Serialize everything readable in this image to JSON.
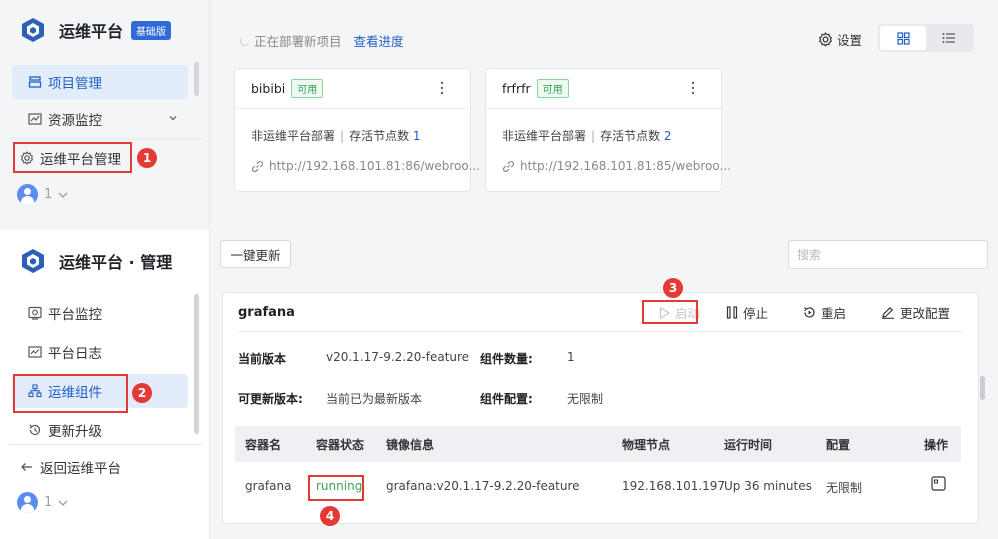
{
  "top": {
    "brand": {
      "title": "运维平台",
      "badge": "基础版"
    },
    "nav": [
      {
        "label": "项目管理",
        "icon": "project-icon",
        "active": true
      },
      {
        "label": "资源监控",
        "icon": "monitor-chart-icon"
      }
    ],
    "footer_nav": {
      "label": "运维平台管理",
      "icon": "gear-icon"
    },
    "user": {
      "count": "1"
    },
    "deploy_status": "正在部署新项目",
    "progress_link": "查看进度",
    "settings_label": "设置",
    "projects": [
      {
        "name": "bibibi",
        "status": "可用",
        "type": "非运维平台部署",
        "nodes_label": "存活节点数",
        "nodes": "1",
        "url": "http://192.168.101.81:86/webroo..."
      },
      {
        "name": "frfrfr",
        "status": "可用",
        "type": "非运维平台部署",
        "nodes_label": "存活节点数",
        "nodes": "2",
        "url": "http://192.168.101.81:85/webroo..."
      }
    ]
  },
  "bottom": {
    "brand": {
      "title": "运维平台 · 管理"
    },
    "nav": [
      {
        "label": "平台监控",
        "icon": "platform-monitor-icon"
      },
      {
        "label": "平台日志",
        "icon": "log-icon"
      },
      {
        "label": "运维组件",
        "icon": "component-icon",
        "active": true
      },
      {
        "label": "更新升级",
        "icon": "update-icon"
      }
    ],
    "back_label": "返回运维平台",
    "user": {
      "count": "1"
    },
    "one_click_update": "一键更新",
    "search_placeholder": "搜索",
    "component": {
      "name": "grafana",
      "actions": {
        "start": "启动",
        "stop": "停止",
        "restart": "重启",
        "change_config": "更改配置"
      },
      "current_version_label": "当前版本",
      "current_version": "v20.1.17-9.2.20-feature",
      "component_count_label": "组件数量:",
      "component_count": "1",
      "updatable_label": "可更新版本:",
      "updatable_value": "当前已为最新版本",
      "component_config_label": "组件配置:",
      "component_config": "无限制",
      "table": {
        "headers": [
          "容器名",
          "容器状态",
          "镜像信息",
          "物理节点",
          "运行时间",
          "配置",
          "操作"
        ],
        "rows": [
          {
            "name": "grafana",
            "status": "running",
            "image": "grafana:v20.1.17-9.2.20-feature",
            "node": "192.168.101.197",
            "uptime": "Up 36 minutes",
            "config": "无限制"
          }
        ]
      }
    }
  },
  "annotations": [
    "1",
    "2",
    "3",
    "4"
  ],
  "colors": {
    "accent": "#2160c4",
    "annotation": "#e53935",
    "running": "#3aa655",
    "badge": "#2f6bd8"
  }
}
